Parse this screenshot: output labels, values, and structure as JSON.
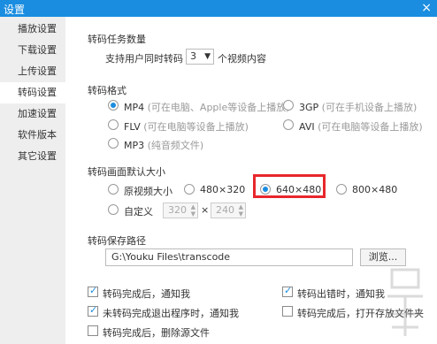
{
  "window": {
    "title": "设置",
    "close_glyph": "×"
  },
  "sidebar": {
    "items": [
      {
        "label": "播放设置"
      },
      {
        "label": "下载设置"
      },
      {
        "label": "上传设置"
      },
      {
        "label": "转码设置",
        "active": true
      },
      {
        "label": "加速设置"
      },
      {
        "label": "软件版本"
      },
      {
        "label": "其它设置"
      }
    ]
  },
  "task_count": {
    "title": "转码任务数量",
    "prefix": "支持用户同时转码",
    "value": "3",
    "suffix": "个视频内容"
  },
  "format": {
    "title": "转码格式",
    "options": [
      {
        "name": "MP4",
        "hint": "(可在电脑、Apple等设备上播放)",
        "checked": true
      },
      {
        "name": "3GP",
        "hint": "(可在手机设备上播放)",
        "checked": false
      },
      {
        "name": "FLV",
        "hint": "(可在电脑等设备上播放)",
        "checked": false
      },
      {
        "name": "AVI",
        "hint": "(可在电脑等设备上播放)",
        "checked": false
      },
      {
        "name": "MP3",
        "hint": "(纯音频文件)",
        "checked": false
      }
    ]
  },
  "size": {
    "title": "转码画面默认大小",
    "options": [
      {
        "label": "原视频大小",
        "checked": false
      },
      {
        "label": "480×320",
        "checked": false
      },
      {
        "label": "640×480",
        "checked": true
      },
      {
        "label": "800×480",
        "checked": false
      }
    ],
    "custom_label": "自定义",
    "custom_width": "320",
    "custom_height": "240",
    "times": "×"
  },
  "save_path": {
    "title": "转码保存路径",
    "value": "G:\\Youku Files\\transcode",
    "browse_label": "浏览..."
  },
  "checks": [
    {
      "label": "转码完成后，通知我",
      "checked": true
    },
    {
      "label": "转码出错时，通知我",
      "checked": true
    },
    {
      "label": "未转码完成退出程序时，通知我",
      "checked": true
    },
    {
      "label": "转码完成后，打开存放文件夹",
      "checked": false
    },
    {
      "label": "转码完成后，删除源文件",
      "checked": false
    }
  ],
  "colors": {
    "accent": "#1a8de0",
    "highlight": "#e8272b",
    "sidebar_bg": "#eeeeee"
  }
}
